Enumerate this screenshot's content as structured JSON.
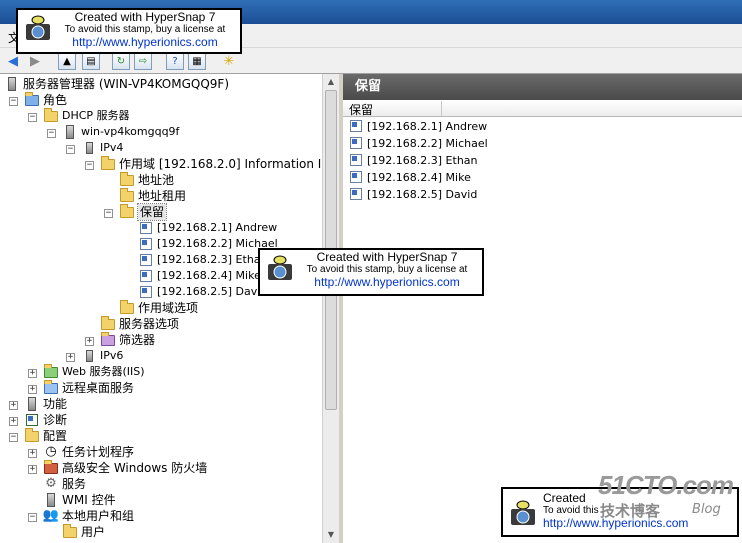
{
  "menu": {
    "items": [
      "文"
    ]
  },
  "tree": {
    "root": "服务器管理器 (WIN-VP4KOMGQQ9F)",
    "roles": "角色",
    "dhcp": "DHCP 服务器",
    "server": "win-vp4komgqq9f",
    "ipv4": "IPv4",
    "scope": "作用域 [192.168.2.0] Information I",
    "address_pool": "地址池",
    "address_leases": "地址租用",
    "reservations": "保留",
    "reservation_items": [
      "[192.168.2.1] Andrew",
      "[192.168.2.2] Michael",
      "[192.168.2.3] Ethan",
      "[192.168.2.4] Mike",
      "[192.168.2.5] David"
    ],
    "scope_options": "作用域选项",
    "server_options": "服务器选项",
    "filters": "筛选器",
    "ipv6": "IPv6",
    "web_server": "Web 服务器(IIS)",
    "remote_desktop": "远程桌面服务",
    "features": "功能",
    "diagnostics": "诊断",
    "configuration": "配置",
    "task_scheduler": "任务计划程序",
    "firewall": "高级安全 Windows 防火墙",
    "services": "服务",
    "wmi": "WMI 控件",
    "local_users": "本地用户和组",
    "users": "用户"
  },
  "right": {
    "header": "保留",
    "column": "保留",
    "items": [
      "[192.168.2.1] Andrew",
      "[192.168.2.2] Michael",
      "[192.168.2.3] Ethan",
      "[192.168.2.4] Mike",
      "[192.168.2.5] David"
    ]
  },
  "stamp": {
    "line1": "Created with HyperSnap 7",
    "line2": "To avoid this stamp, buy a license at",
    "line3": "http://www.hyperionics.com",
    "line1_partial": "Created",
    "line2_partial": "To avoid this",
    "line3_partial": "http://www.hyperionics.com"
  },
  "watermark": {
    "brand": "51CTO.com",
    "sub": "技术博客",
    "blog": "Blog"
  },
  "colors": {
    "accent": "#2f6fb6",
    "link": "#0033cc",
    "header": "#4a4a4a"
  }
}
